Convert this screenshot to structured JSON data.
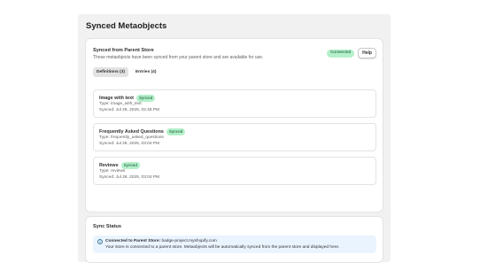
{
  "page": {
    "title": "Synced Metaobjects"
  },
  "section": {
    "title": "Synced from Parent Store",
    "description": "These metaobjects have been synced from your parent store and are available for use.",
    "connected_badge": "Connected",
    "help_label": "Help"
  },
  "tabs": [
    {
      "label": "Definitions (3)",
      "active": true
    },
    {
      "label": "Entries (4)",
      "active": false
    }
  ],
  "definitions": [
    {
      "name": "Image with text",
      "badge": "Synced",
      "type": "Type: image_with_text",
      "synced": "Synced: Jul 28, 2025, 02:48 PM"
    },
    {
      "name": "Frequently Asked Questions",
      "badge": "Synced",
      "type": "Type: frequently_asked_questions",
      "synced": "Synced: Jul 28, 2025, 03:04 PM"
    },
    {
      "name": "Reviews",
      "badge": "Synced",
      "type": "Type: reviews",
      "synced": "Synced: Jul 28, 2025, 03:04 PM"
    }
  ],
  "sync_status": {
    "title": "Sync Status",
    "banner_heading": "Connected to Parent Store:",
    "store": "badge-project.myshopify.com",
    "banner_body": "Your store is connected to a parent store. Metaobjects will be automatically synced from the parent store and displayed here.",
    "icon": "info-icon"
  },
  "colors": {
    "success_bg": "#b4f0c9",
    "success_text": "#0c5132",
    "info_bg": "#eaf4ff",
    "info_icon": "#00527c"
  }
}
